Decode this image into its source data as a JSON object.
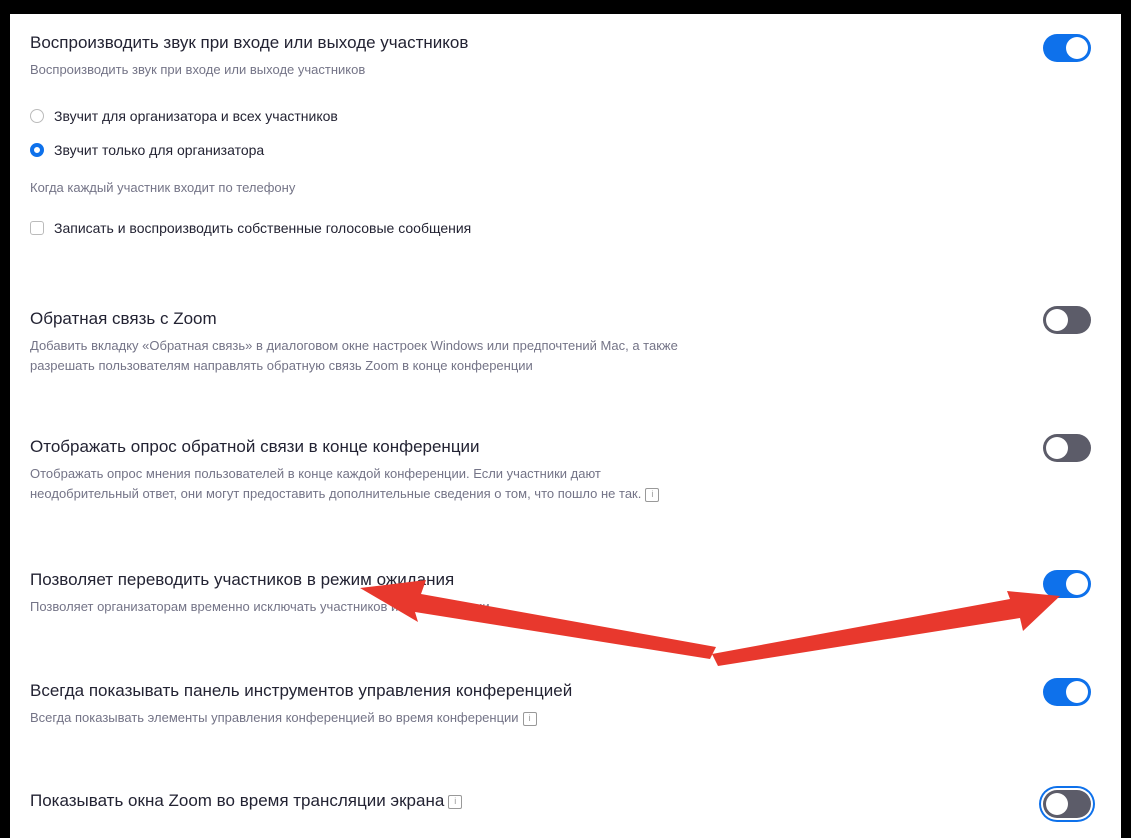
{
  "settings": {
    "sound": {
      "title": "Воспроизводить звук при входе или выходе участников",
      "desc": "Воспроизводить звук при входе или выходе участников",
      "enabled": true,
      "options": [
        {
          "label": "Звучит для организатора и всех участников",
          "selected": false
        },
        {
          "label": "Звучит только для организатора",
          "selected": true
        }
      ],
      "phone_label": "Когда каждый участник входит по телефону",
      "record_label": "Записать и воспроизводить собственные голосовые сообщения",
      "record_checked": false
    },
    "feedback": {
      "title": "Обратная связь с Zoom",
      "desc_line1": "Добавить вкладку «Обратная связь» в диалоговом окне настроек Windows или предпочтений Mac, а также",
      "desc_line2": "разрешать пользователям направлять обратную связь Zoom в конце конференции",
      "enabled": false
    },
    "survey": {
      "title": "Отображать опрос обратной связи в конце конференции",
      "desc_line1": "Отображать опрос мнения пользователей в конце каждой конференции. Если участники дают",
      "desc_line2": "неодобрительный ответ, они могут предоставить дополнительные сведения о том, что пошло не так.",
      "enabled": false
    },
    "waiting": {
      "title": "Позволяет переводить участников в режим ожидания",
      "desc": "Позволяет организаторам временно исключать участников из конференции.",
      "enabled": true
    },
    "toolbar": {
      "title": "Всегда показывать панель инструментов управления конференцией",
      "desc": "Всегда показывать элементы управления конференцией во время конференции",
      "enabled": true
    },
    "share": {
      "title": "Показывать окна Zoom во время трансляции экрана",
      "enabled": false
    }
  },
  "annotation": {
    "arrow_color": "#e8382d"
  }
}
